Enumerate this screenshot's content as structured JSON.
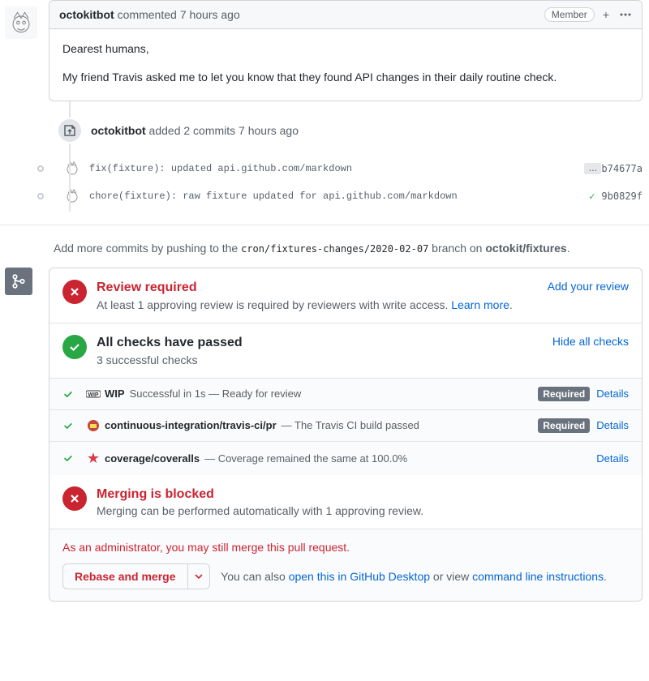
{
  "comment": {
    "author": "octokitbot",
    "action": "commented",
    "time": "7 hours ago",
    "member_label": "Member",
    "body_line1": "Dearest humans,",
    "body_line2": "My friend Travis asked me to let you know that they found API changes in their daily routine check."
  },
  "commits_event": {
    "author": "octokitbot",
    "text_mid": "added 2 commits",
    "time": "7 hours ago"
  },
  "commits": [
    {
      "msg": "fix(fixture): updated api.github.com/markdown",
      "has_ellipsis": true,
      "sha": "b74677a",
      "passed": false
    },
    {
      "msg": "chore(fixture): raw fixture updated for api.github.com/markdown",
      "has_ellipsis": false,
      "sha": "9b0829f",
      "passed": true
    }
  ],
  "push_hint": {
    "prefix": "Add more commits by pushing to the ",
    "branch": "cron/fixtures-changes/2020-02-07",
    "mid": " branch on ",
    "repo": "octokit/fixtures",
    "suffix": "."
  },
  "review": {
    "title": "Review required",
    "desc_prefix": "At least 1 approving review is required by reviewers with write access. ",
    "learn_more": "Learn more",
    "desc_suffix": ".",
    "action": "Add your review"
  },
  "checks_header": {
    "title": "All checks have passed",
    "desc": "3 successful checks",
    "action": "Hide all checks"
  },
  "checks": [
    {
      "name": "WIP",
      "desc": "Successful in 1s — Ready for review",
      "required": true,
      "details": "Details",
      "icon": "wip"
    },
    {
      "name": "continuous-integration/travis-ci/pr",
      "desc": " — The Travis CI build passed",
      "required": true,
      "details": "Details",
      "icon": "travis"
    },
    {
      "name": "coverage/coveralls",
      "desc": " — Coverage remained the same at 100.0%",
      "required": false,
      "details": "Details",
      "icon": "star"
    }
  ],
  "required_label": "Required",
  "blocked": {
    "title": "Merging is blocked",
    "desc": "Merging can be performed automatically with 1 approving review."
  },
  "footer": {
    "admin_note": "As an administrator, you may still merge this pull request.",
    "merge_btn": "Rebase and merge",
    "post_prefix": "You can also ",
    "desktop_link": "open this in GitHub Desktop",
    "post_mid": " or view ",
    "cli_link": "command line instructions",
    "post_suffix": "."
  }
}
